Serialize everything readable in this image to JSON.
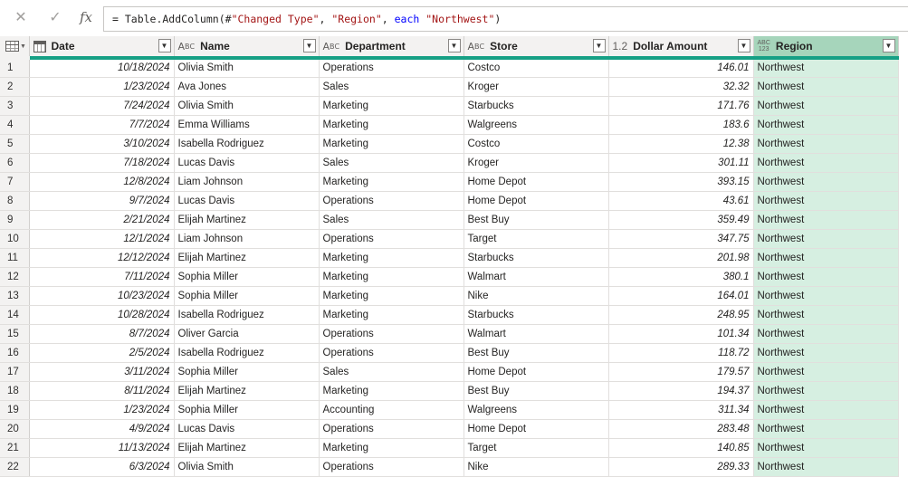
{
  "formula_bar": {
    "cancel_icon": "x-icon",
    "commit_icon": "check-icon",
    "fx_label": "fx",
    "formula_prefix": "= Table.AddColumn(#",
    "formula_arg1": "\"Changed Type\"",
    "formula_sep1": ", ",
    "formula_arg2": "\"Region\"",
    "formula_sep2": ", ",
    "formula_kw": "each",
    "formula_sep3": " ",
    "formula_arg3": "\"Northwest\"",
    "formula_suffix": ")"
  },
  "columns": [
    {
      "label": "Date",
      "type_icon": "calendar-icon"
    },
    {
      "label": "Name",
      "type_icon": "ABC"
    },
    {
      "label": "Department",
      "type_icon": "ABC"
    },
    {
      "label": "Store",
      "type_icon": "ABC"
    },
    {
      "label": "Dollar Amount",
      "type_icon": "1.2"
    },
    {
      "label": "Region",
      "type_icon": "ABC123"
    }
  ],
  "type_icons": {
    "text_top": "A",
    "text_sup": "B",
    "text_sub": "C",
    "decimal": "1.2",
    "any_top": "ABC",
    "any_bottom": "123"
  },
  "colors": {
    "accent": "#16a085",
    "region_header": "#a6d5bb",
    "region_cells": "#d6efe1"
  },
  "rows": [
    [
      "1",
      "10/18/2024",
      "Olivia Smith",
      "Operations",
      "Costco",
      "146.01",
      "Northwest"
    ],
    [
      "2",
      "1/23/2024",
      "Ava Jones",
      "Sales",
      "Kroger",
      "32.32",
      "Northwest"
    ],
    [
      "3",
      "7/24/2024",
      "Olivia Smith",
      "Marketing",
      "Starbucks",
      "171.76",
      "Northwest"
    ],
    [
      "4",
      "7/7/2024",
      "Emma Williams",
      "Marketing",
      "Walgreens",
      "183.6",
      "Northwest"
    ],
    [
      "5",
      "3/10/2024",
      "Isabella Rodriguez",
      "Marketing",
      "Costco",
      "12.38",
      "Northwest"
    ],
    [
      "6",
      "7/18/2024",
      "Lucas Davis",
      "Sales",
      "Kroger",
      "301.11",
      "Northwest"
    ],
    [
      "7",
      "12/8/2024",
      "Liam Johnson",
      "Marketing",
      "Home Depot",
      "393.15",
      "Northwest"
    ],
    [
      "8",
      "9/7/2024",
      "Lucas Davis",
      "Operations",
      "Home Depot",
      "43.61",
      "Northwest"
    ],
    [
      "9",
      "2/21/2024",
      "Elijah Martinez",
      "Sales",
      "Best Buy",
      "359.49",
      "Northwest"
    ],
    [
      "10",
      "12/1/2024",
      "Liam Johnson",
      "Operations",
      "Target",
      "347.75",
      "Northwest"
    ],
    [
      "11",
      "12/12/2024",
      "Elijah Martinez",
      "Marketing",
      "Starbucks",
      "201.98",
      "Northwest"
    ],
    [
      "12",
      "7/11/2024",
      "Sophia Miller",
      "Marketing",
      "Walmart",
      "380.1",
      "Northwest"
    ],
    [
      "13",
      "10/23/2024",
      "Sophia Miller",
      "Marketing",
      "Nike",
      "164.01",
      "Northwest"
    ],
    [
      "14",
      "10/28/2024",
      "Isabella Rodriguez",
      "Marketing",
      "Starbucks",
      "248.95",
      "Northwest"
    ],
    [
      "15",
      "8/7/2024",
      "Oliver Garcia",
      "Operations",
      "Walmart",
      "101.34",
      "Northwest"
    ],
    [
      "16",
      "2/5/2024",
      "Isabella Rodriguez",
      "Operations",
      "Best Buy",
      "118.72",
      "Northwest"
    ],
    [
      "17",
      "3/11/2024",
      "Sophia Miller",
      "Sales",
      "Home Depot",
      "179.57",
      "Northwest"
    ],
    [
      "18",
      "8/11/2024",
      "Elijah Martinez",
      "Marketing",
      "Best Buy",
      "194.37",
      "Northwest"
    ],
    [
      "19",
      "1/23/2024",
      "Sophia Miller",
      "Accounting",
      "Walgreens",
      "311.34",
      "Northwest"
    ],
    [
      "20",
      "4/9/2024",
      "Lucas Davis",
      "Operations",
      "Home Depot",
      "283.48",
      "Northwest"
    ],
    [
      "21",
      "11/13/2024",
      "Elijah Martinez",
      "Marketing",
      "Target",
      "140.85",
      "Northwest"
    ],
    [
      "22",
      "6/3/2024",
      "Olivia Smith",
      "Operations",
      "Nike",
      "289.33",
      "Northwest"
    ]
  ]
}
